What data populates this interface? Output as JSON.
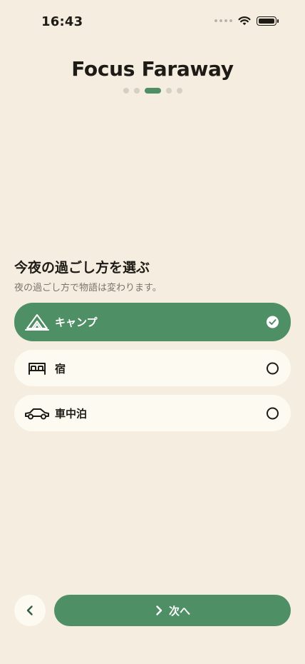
{
  "status_bar": {
    "time": "16:43"
  },
  "header": {
    "title": "Focus Faraway",
    "pager": {
      "count": 5,
      "active_index": 2
    }
  },
  "section": {
    "title": "今夜の過ごし方を選ぶ",
    "subtitle": "夜の過ごし方で物語は変わります。"
  },
  "options": [
    {
      "label": "キャンプ",
      "icon": "tent-icon",
      "selected": true
    },
    {
      "label": "宿",
      "icon": "bed-icon",
      "selected": false
    },
    {
      "label": "車中泊",
      "icon": "car-icon",
      "selected": false
    }
  ],
  "footer": {
    "back_icon": "chevron-left-icon",
    "next_label": "次へ",
    "next_icon": "chevron-right-icon"
  },
  "colors": {
    "background": "#f5eee0",
    "accent": "#4f8f65",
    "card": "#fdfaf1",
    "text": "#1e1b16",
    "muted": "#7a746b"
  }
}
